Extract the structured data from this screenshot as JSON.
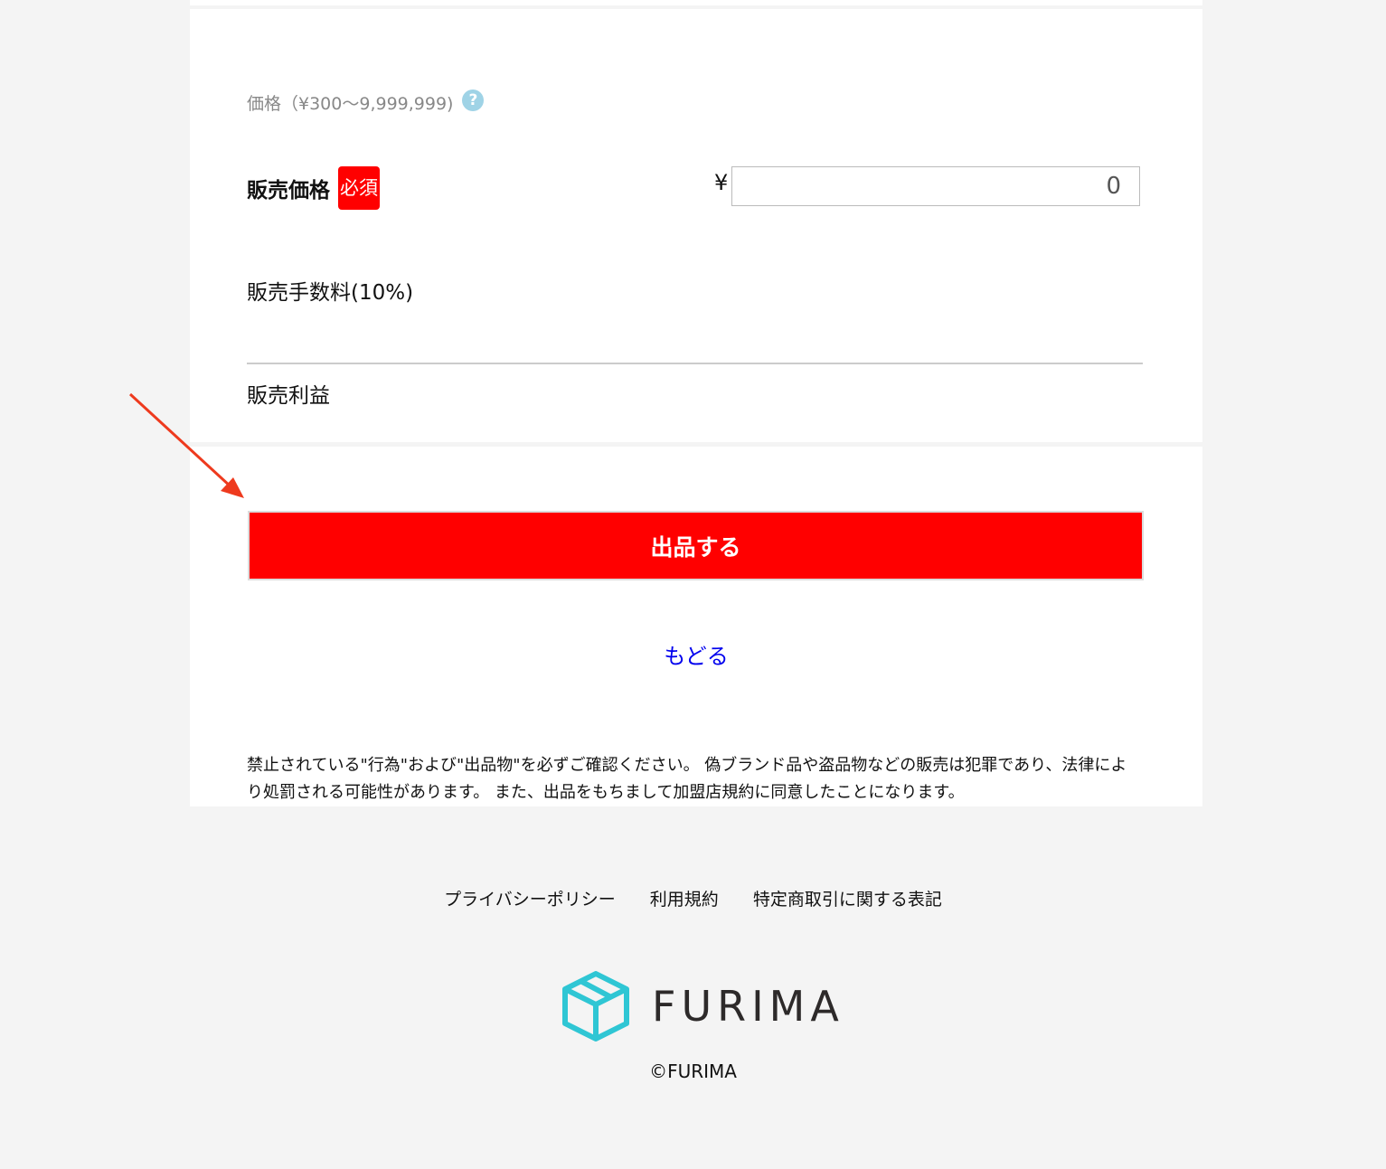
{
  "price_section": {
    "heading": "価格（¥300〜9,999,999)",
    "help_icon": "question-circle-icon",
    "sale_price_label": "販売価格",
    "required_badge": "必須",
    "currency_symbol": "¥",
    "price_placeholder": "0",
    "fee_label": "販売手数料(10%)",
    "profit_label": "販売利益"
  },
  "submit_section": {
    "submit_label": "出品する",
    "back_label": "もどる",
    "notice": "禁止されている\"行為\"および\"出品物\"を必ずご確認ください。 偽ブランド品や盗品物などの販売は犯罪であり、法律により処罰される可能性があります。 また、出品をもちまして加盟店規約に同意したことになります。"
  },
  "annotation": {
    "icon": "red-arrow-icon",
    "color": "#ee3a1e"
  },
  "footer": {
    "links": [
      "プライバシーポリシー",
      "利用規約",
      "特定商取引に関する表記"
    ],
    "logo_text": "FURIMA",
    "logo_icon": "cube-icon",
    "logo_color": "#2fc6d4",
    "copyright": "©FURIMA"
  },
  "colors": {
    "accent": "#ff0000",
    "link": "#0000ee",
    "background": "#f4f4f4"
  }
}
